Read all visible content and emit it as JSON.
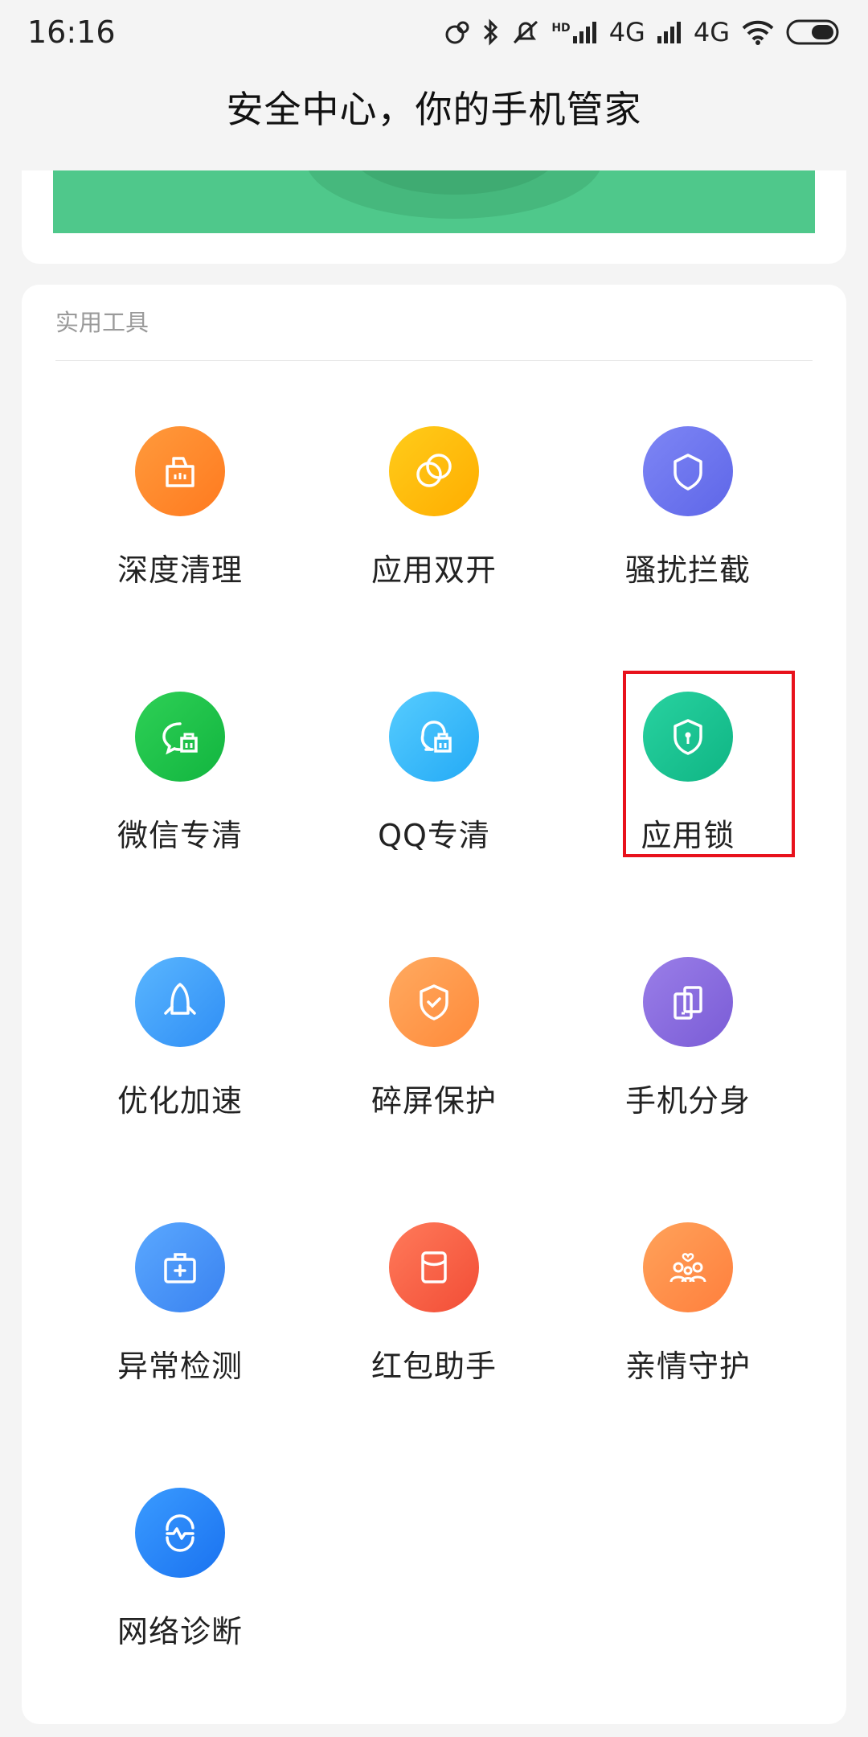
{
  "status_bar": {
    "time": "16:16",
    "network_1": "4G",
    "network_2": "4G",
    "hd_label": "HD"
  },
  "header": {
    "title": "安全中心，你的手机管家"
  },
  "tools": {
    "section_title": "实用工具",
    "items": [
      {
        "label": "深度清理",
        "icon": "cleanup-bag-icon",
        "color_start": "#ff9a3c",
        "color_end": "#ff7a1f"
      },
      {
        "label": "应用双开",
        "icon": "dual-apps-icon",
        "color_start": "#ffcc1a",
        "color_end": "#ffad00"
      },
      {
        "label": "骚扰拦截",
        "icon": "shield-block-icon",
        "color_start": "#7e86f5",
        "color_end": "#5e66e8"
      },
      {
        "label": "微信专清",
        "icon": "wechat-clean-icon",
        "color_start": "#2ed056",
        "color_end": "#12b53f"
      },
      {
        "label": "QQ专清",
        "icon": "qq-clean-icon",
        "color_start": "#56ccff",
        "color_end": "#24aaf5"
      },
      {
        "label": "应用锁",
        "icon": "app-lock-icon",
        "color_start": "#28d2a0",
        "color_end": "#0fb584"
      },
      {
        "label": "优化加速",
        "icon": "rocket-boost-icon",
        "color_start": "#5ab6ff",
        "color_end": "#2f8ef5"
      },
      {
        "label": "碎屏保护",
        "icon": "screen-protect-icon",
        "color_start": "#ffaa60",
        "color_end": "#ff8a3a"
      },
      {
        "label": "手机分身",
        "icon": "second-space-icon",
        "color_start": "#9a7ee8",
        "color_end": "#7a5cd6"
      },
      {
        "label": "异常检测",
        "icon": "medical-kit-icon",
        "color_start": "#5aa8ff",
        "color_end": "#3a82f0"
      },
      {
        "label": "红包助手",
        "icon": "red-packet-icon",
        "color_start": "#ff7a5a",
        "color_end": "#f24d36"
      },
      {
        "label": "亲情守护",
        "icon": "family-guard-icon",
        "color_start": "#ffa25a",
        "color_end": "#ff7f3d"
      },
      {
        "label": "网络诊断",
        "icon": "network-diagnose-icon",
        "color_start": "#3a9bff",
        "color_end": "#1a72f0"
      }
    ]
  }
}
